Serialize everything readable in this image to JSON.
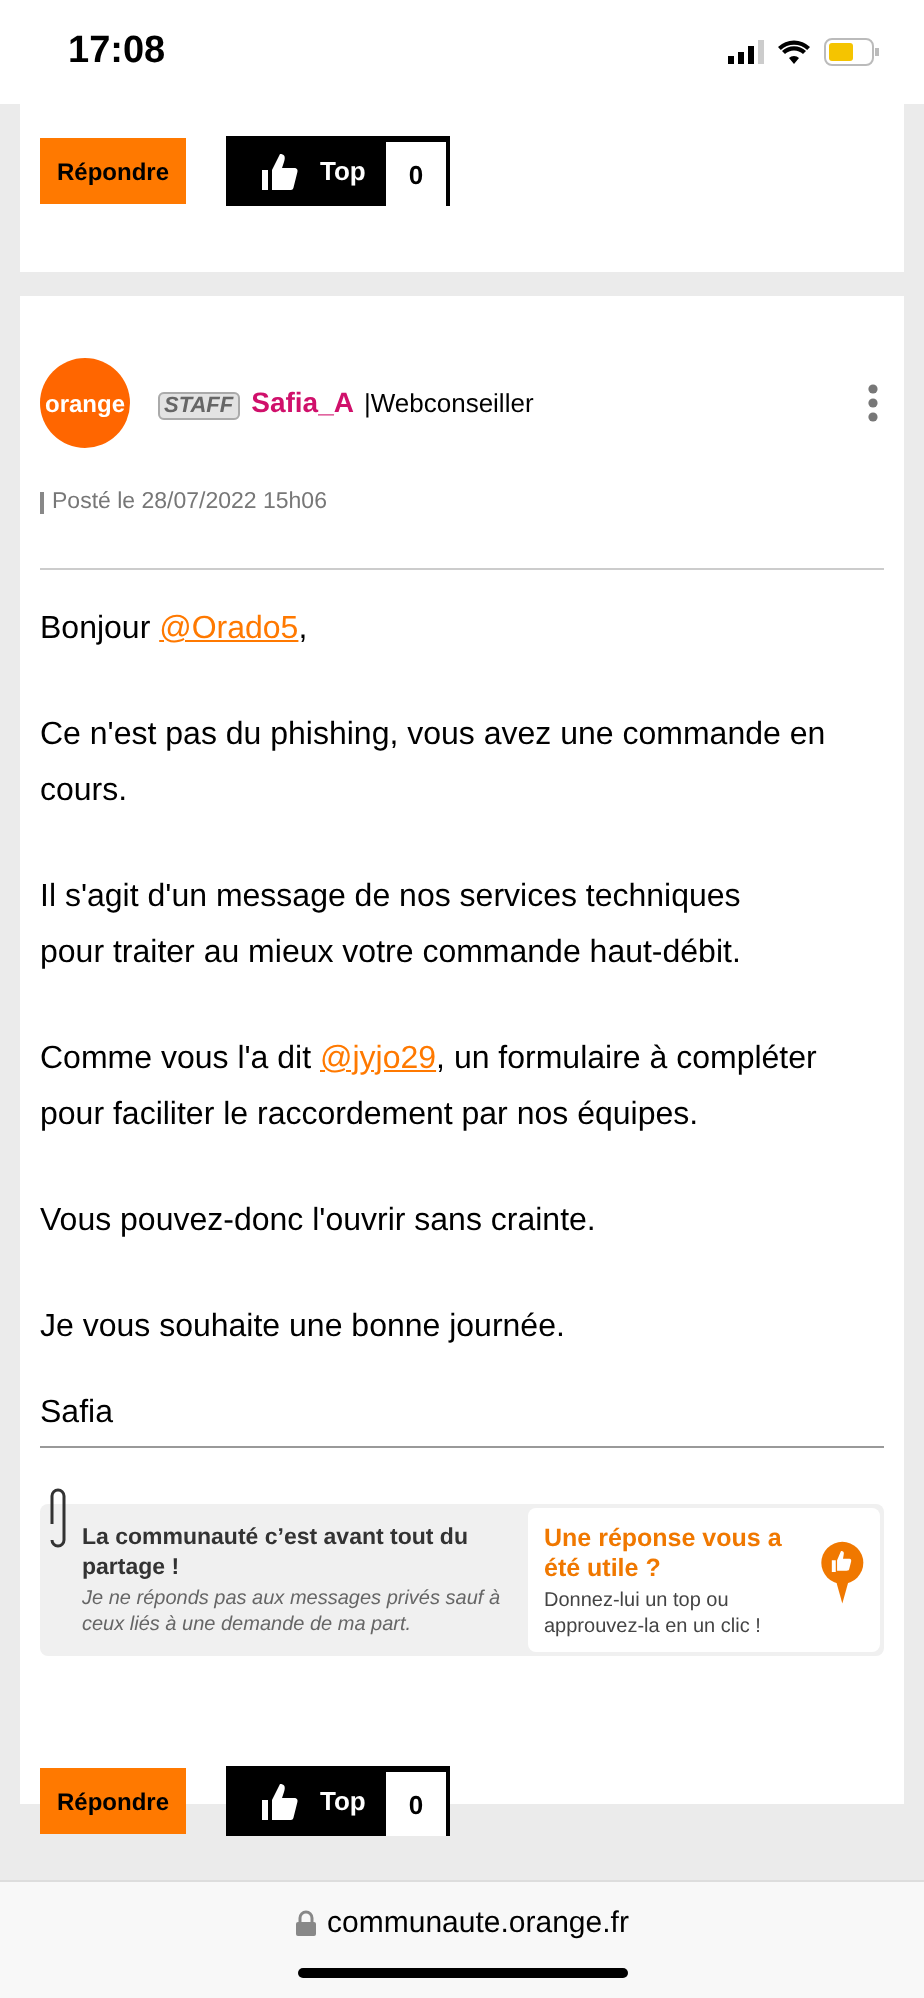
{
  "status_bar": {
    "time": "17:08"
  },
  "previous_post": {
    "reply_button": "Répondre",
    "top_button": {
      "label": "Top",
      "count": "0"
    }
  },
  "post": {
    "avatar": "orange",
    "badge": "STAFF",
    "author": "Safia_A",
    "role": "|Webconseiller",
    "posted": "Posté le 28/07/2022 15h06",
    "paragraphs": [
      {
        "lines": [
          [
            {
              "kind": "text",
              "text": "Bonjour "
            },
            {
              "kind": "mention",
              "text": "@Orado5"
            },
            {
              "kind": "text",
              "text": ","
            }
          ]
        ]
      },
      {
        "lines": [
          [
            {
              "kind": "text",
              "text": "Ce n'est pas du phishing, vous avez une commande en cours."
            }
          ]
        ]
      },
      {
        "lines": [
          [
            {
              "kind": "text",
              "text": "Il s'agit d'un message de nos services techniques"
            }
          ],
          [
            {
              "kind": "text",
              "text": "pour traiter au mieux votre commande haut-débit."
            }
          ]
        ]
      },
      {
        "lines": [
          [
            {
              "kind": "text",
              "text": "Comme vous l'a dit "
            },
            {
              "kind": "mention",
              "text": "@jyjo29"
            },
            {
              "kind": "text",
              "text": ", un formulaire à compléter pour faciliter le raccordement par nos équipes."
            }
          ]
        ]
      },
      {
        "lines": [
          [
            {
              "kind": "text",
              "text": "Vous pouvez-donc l'ouvrir sans crainte."
            }
          ]
        ]
      },
      {
        "lines": [
          [
            {
              "kind": "text",
              "text": "Je vous souhaite une bonne journée."
            }
          ]
        ]
      }
    ],
    "signature": "Safia",
    "banner": {
      "title": "La communauté c’est avant tout du partage !",
      "note": "Je ne réponds pas aux messages privés sauf à ceux liés à une demande de ma part.",
      "cta_title": "Une réponse vous a été utile ?",
      "cta_text": "Donnez-lui un top ou approuvez-la en un clic !"
    },
    "reply_button": "Répondre",
    "top_button": {
      "label": "Top",
      "count": "0"
    }
  },
  "browser": {
    "url": "communaute.orange.fr"
  }
}
